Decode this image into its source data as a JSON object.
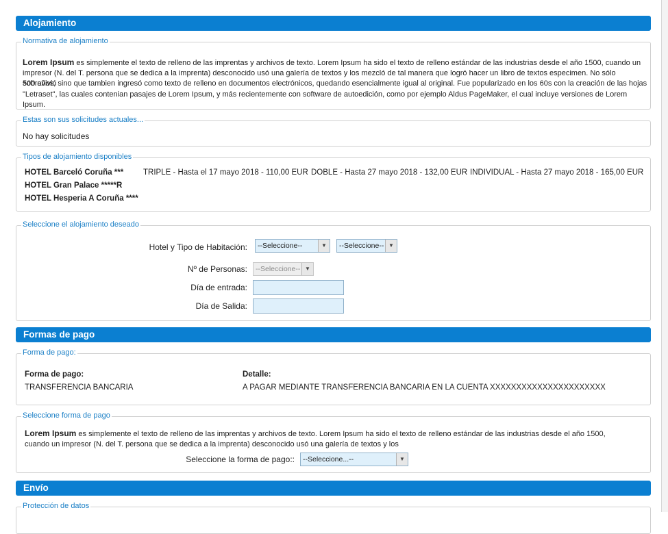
{
  "alojamiento": {
    "header": "Alojamiento",
    "normativa": {
      "legend": "Normativa de alojamiento",
      "lead": "Lorem Ipsum",
      "body_line1": " es simplemente el texto de relleno de las imprentas y archivos de texto. Lorem Ipsum ha sido el texto de relleno estándar de las industrias desde el año 1500, cuando un",
      "body_line2": "impresor (N. del T. persona que se dedica a la imprenta) desconocido usó una galería de textos y los mezcló de tal manera que logró hacer un libro de textos especimen. No sólo sobrevivió",
      "body_line3": "500 años, sino que tambien ingresó como texto de relleno en documentos electrónicos, quedando esencialmente igual al original. Fue popularizado en los 60s con la creación de las hojas",
      "body_line4": "\"Letraset\", las cuales contenian pasajes de Lorem Ipsum, y más recientemente con software de autoedición, como por ejemplo Aldus PageMaker, el cual incluye versiones de Lorem Ipsum."
    },
    "solicitudes": {
      "legend": "Estas son sus solicitudes actuales...",
      "text": "No hay solicitudes"
    },
    "tipos": {
      "legend": "Tipos de alojamiento disponibles",
      "hotels": [
        "HOTEL Barceló Coruña ***",
        "HOTEL Gran Palace *****R",
        "HOTEL Hesperia A Coruña ****"
      ],
      "rates": [
        "TRIPLE - Hasta el 17 mayo 2018 - 110,00 EUR",
        "DOBLE - Hasta 27 mayo 2018 - 132,00 EUR",
        "INDIVIDUAL - Hasta 27 mayo 2018 - 165,00 EUR"
      ]
    },
    "seleccion": {
      "legend": "Seleccione el alojamiento deseado",
      "hotel_label": "Hotel y Tipo de Habitación:",
      "hotel_select": "--Seleccione--",
      "tipo_select": "--Seleccione--",
      "personas_label": "Nº de Personas:",
      "personas_select": "--Seleccione--",
      "entrada_label": "Día de entrada:",
      "salida_label": "Día de Salida:"
    }
  },
  "formas_pago": {
    "header": "Formas de pago",
    "forma": {
      "legend": "Forma de pago:",
      "col1_header": "Forma de pago:",
      "col2_header": "Detalle:",
      "col1_value": "TRANSFERENCIA BANCARIA",
      "col2_value": "A PAGAR MEDIANTE TRANSFERENCIA BANCARIA EN LA CUENTA XXXXXXXXXXXXXXXXXXXXXX"
    },
    "seleccione": {
      "legend": "Seleccione forma de pago",
      "lead": "Lorem Ipsum",
      "body_line1": " es simplemente el texto de relleno de las imprentas y archivos de texto. Lorem Ipsum ha sido el texto de relleno estándar de las industrias desde el año 1500,",
      "body_line2": "cuando un impresor (N. del T. persona que se dedica a la imprenta) desconocido usó una galería de textos y los",
      "select_label": "Seleccione la forma de pago::",
      "select_value": "--Seleccione...--"
    }
  },
  "envio": {
    "header": "Envío",
    "proteccion_legend": "Protección de datos"
  },
  "colors": {
    "header_bg": "#0b7fd1",
    "legend_text": "#1a7fc6",
    "input_bg": "#dff0fb"
  }
}
